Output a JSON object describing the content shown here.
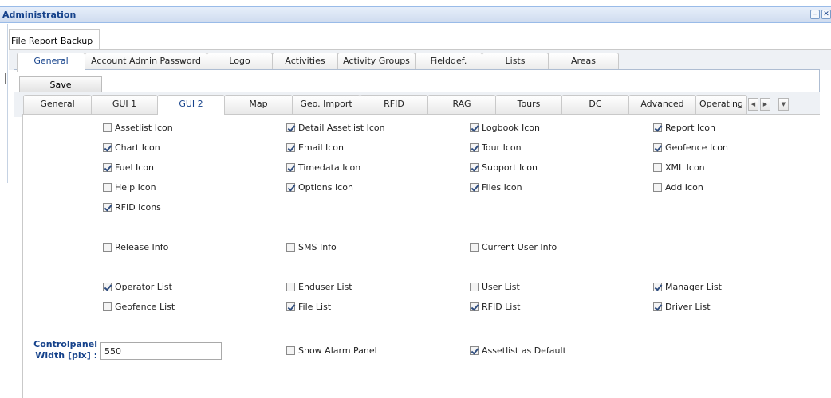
{
  "window": {
    "title": "Administration",
    "minimize_glyph": "–",
    "close_glyph": "✕"
  },
  "level1_tab": "File Report Backup",
  "level2_tabs": [
    "General",
    "Account Admin Password",
    "Logo",
    "Activities",
    "Activity Groups",
    "Fielddef.",
    "Lists",
    "Areas"
  ],
  "save_label": "Save",
  "level3_tabs": [
    "General",
    "GUI 1",
    "GUI 2",
    "Map",
    "Geo. Import",
    "RFID",
    "RAG",
    "Tours",
    "DC",
    "Advanced",
    "Operating"
  ],
  "scroll_glyphs": {
    "left": "◀",
    "right": "▶",
    "menu": "▼"
  },
  "checkboxes": {
    "r1": [
      {
        "label": "Assetlist Icon",
        "checked": false
      },
      {
        "label": "Detail Assetlist Icon",
        "checked": true
      },
      {
        "label": "Logbook Icon",
        "checked": true
      },
      {
        "label": "Report Icon",
        "checked": true
      }
    ],
    "r2": [
      {
        "label": "Chart Icon",
        "checked": true
      },
      {
        "label": "Email Icon",
        "checked": true
      },
      {
        "label": "Tour Icon",
        "checked": true
      },
      {
        "label": "Geofence Icon",
        "checked": true
      }
    ],
    "r3": [
      {
        "label": "Fuel Icon",
        "checked": true
      },
      {
        "label": "Timedata Icon",
        "checked": true
      },
      {
        "label": "Support Icon",
        "checked": true
      },
      {
        "label": "XML Icon",
        "checked": false
      }
    ],
    "r4": [
      {
        "label": "Help Icon",
        "checked": false
      },
      {
        "label": "Options Icon",
        "checked": true
      },
      {
        "label": "Files Icon",
        "checked": true
      },
      {
        "label": "Add Icon",
        "checked": false
      }
    ],
    "r5": [
      {
        "label": "RFID Icons",
        "checked": true
      }
    ],
    "r6": [
      {
        "label": "Release Info",
        "checked": false
      },
      {
        "label": "SMS Info",
        "checked": false
      },
      {
        "label": "Current User Info",
        "checked": false
      }
    ],
    "r7": [
      {
        "label": "Operator List",
        "checked": true
      },
      {
        "label": "Enduser List",
        "checked": false
      },
      {
        "label": "User List",
        "checked": false
      },
      {
        "label": "Manager List",
        "checked": true
      }
    ],
    "r8": [
      {
        "label": "Geofence List",
        "checked": false
      },
      {
        "label": "File List",
        "checked": true
      },
      {
        "label": "RFID List",
        "checked": true
      },
      {
        "label": "Driver List",
        "checked": true
      }
    ],
    "r9": [
      {
        "label": "Show Alarm Panel",
        "checked": false
      },
      {
        "label": "Assetlist as Default",
        "checked": true
      }
    ]
  },
  "controlpanel": {
    "label_line1": "Controlpanel",
    "label_line2": "Width [pix] :",
    "value": "550"
  },
  "colors": {
    "title_text": "#15428b",
    "panel_border": "#99bbe8",
    "check_mark": "#2f4d7f"
  }
}
